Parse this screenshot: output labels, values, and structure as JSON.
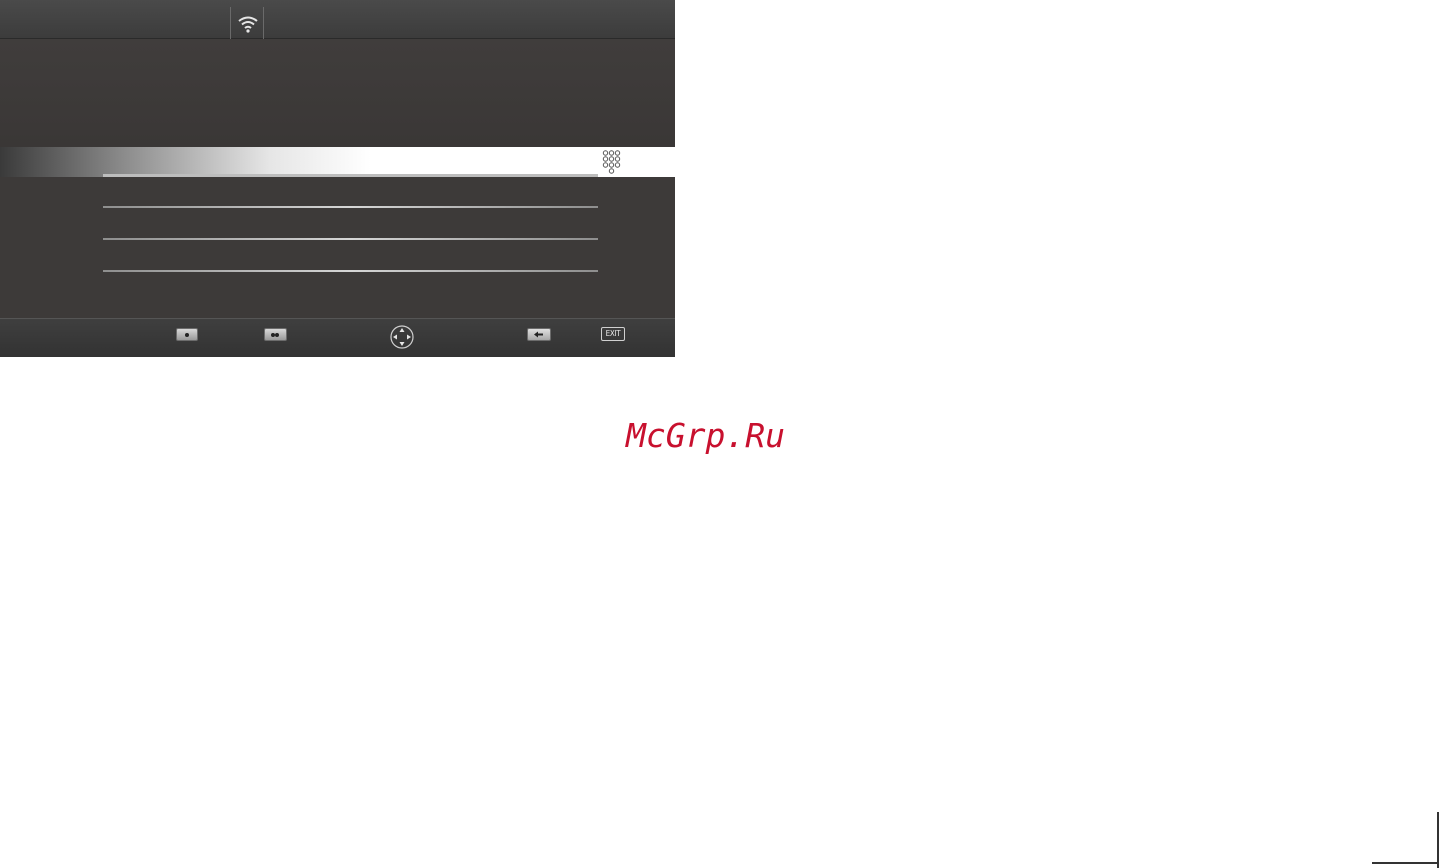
{
  "menu": {
    "rows_visible": 4,
    "footer_keys": {
      "red_key_icon": "red-button-icon",
      "green_key_icon": "green-button-icon",
      "nav_icon": "navigation-cross-icon",
      "back_icon": "back-arrow-icon",
      "exit_label": "EXIT"
    }
  },
  "watermark": {
    "text": "McGrp.Ru",
    "color": "#c8102e"
  },
  "colors": {
    "menu_bg": "#3a3a3a",
    "highlight": "#ffffff"
  }
}
